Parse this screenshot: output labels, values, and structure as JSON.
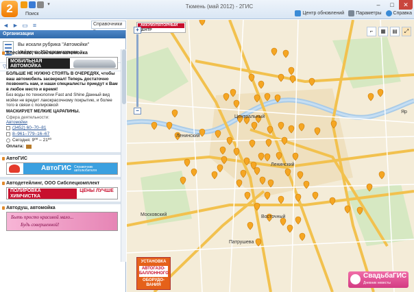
{
  "window": {
    "title": "Тюмень (май 2012) - 2ГИС",
    "logo_letter": "2",
    "search_tab": "Поиск",
    "btn_minimize": "–",
    "btn_maximize": "□",
    "btn_close": "✕"
  },
  "toolbar": {
    "directory_select": "Справочники",
    "updates": "Центр обновлений",
    "settings": "Параметры",
    "help": "Справка"
  },
  "panel": {
    "header": "Организации",
    "rubric_title": "Вы искали рубрика \"Автомойки\"",
    "rubric_count": "Найдено: 102 организации",
    "add_filter": "Добавить фильтр"
  },
  "results": [
    {
      "name": "БлескАвто, мобильная автомойка",
      "banner_line1": "МОБИЛЬНАЯ",
      "banner_line2": "АВТОМОЙКА",
      "ad_bold": "БОЛЬШЕ НЕ НУЖНО СТОЯТЬ В ОЧЕРЕДЯХ, чтобы ваш автомобиль засверкал! Теперь достаточно позвонить нам, и наши специалисты приедут к Вам в любое место и время!",
      "ad_text": "Без воды по технологии Fast and Shine Данный вид мойки не вредит лакокрасочному покрытию, и более того в связи с полировкой",
      "ad_caps": "МАСКИРУЕТ МЕЛКИЕ ЦАРАПИНЫ.",
      "activity_label": "Сфера деятельности:",
      "activity_value": "Автомойки",
      "phone1": "(3452) 60–70–81",
      "phone2": "8–961–779–16–67",
      "hours": "Сегодня: 9⁰⁰ – 21⁰⁰",
      "payment": "Оплата:"
    },
    {
      "name": "АвтоГИС",
      "banner_title": "АвтоГИС",
      "banner_sub": "Справочник автолюбителя"
    },
    {
      "name": "Автодетейлинг, ООО Сибспецкомплект",
      "banner_p1": "ПОЛИРОВКА",
      "banner_p2": "ХИМЧИСТКА",
      "banner_p3": "ЦЕНЫ ЛУЧШЕ"
    },
    {
      "name": "Автодуш, автомойка",
      "banner_d1": "Быть просто красивой мало...",
      "banner_d2": "Будь совершенной!"
    }
  ],
  "map": {
    "labels": {
      "center": "Центральный",
      "leninsky_w": "Ленинский",
      "leninsky": "Ленинский",
      "moskovsky": "Московский",
      "vostochny": "Восточный",
      "patrusheva": "Патрушева",
      "yar": "Яр"
    },
    "top_ad_line1": "АККУМУЛЯТОРНЫЙ",
    "top_ad_line2": "ЦЕНТР",
    "promo_left_1": "УСТАНОВКА",
    "promo_left_2": "АВТОГАЗО-БАЛЛОННОГО",
    "promo_left_3": "ОБОРУДО-ВАНИЯ",
    "promo_right_title": "СвадьбаГИС",
    "promo_right_sub": "Дневник невесты",
    "zoom_in": "+",
    "zoom_out": "−"
  },
  "colors": {
    "accent": "#2f6aab",
    "marker": "#f5a623",
    "road": "#f7c94a",
    "water": "#b9d6ee",
    "park": "#cfe6b8"
  }
}
